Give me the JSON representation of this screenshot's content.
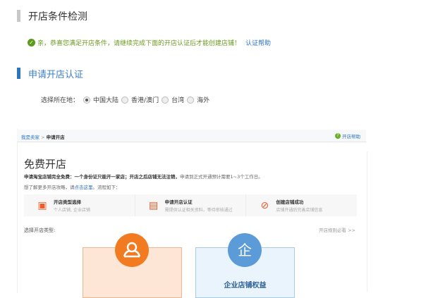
{
  "check_section": {
    "title": "开店条件检测",
    "message": "亲，恭喜您满足开店条件，请继续完成下面的开店认证后才能创建店铺！",
    "help_link": "认证帮助"
  },
  "auth_section": {
    "title": "申请开店认证",
    "location_label": "选择所在地：",
    "options": [
      "中国大陆",
      "香港/澳门",
      "台湾",
      "海外"
    ],
    "selected": "中国大陆"
  },
  "embedded": {
    "breadcrumb": {
      "root": "我是卖家",
      "sep": " > ",
      "current": "申请开店"
    },
    "help": "开店帮助",
    "title": "免费开店",
    "desc_bold": "申请淘宝店铺完全免费：一个身份证只能开一家店；开店之后店铺无法注销，",
    "desc_rest": "申请到正式开通预计需要1~3个工作日。",
    "more_prefix": "想了解更多开店攻略，请",
    "more_link": "点击这里",
    "more_suffix": "。流程如下：",
    "steps": [
      {
        "title": "开店类型选择",
        "sub": "个人店铺, 企业店铺"
      },
      {
        "title": "申请开店认证",
        "sub": "需提供认证相关资料，等待审核通过"
      },
      {
        "title": "创建店铺成功",
        "sub": "店铺开通后完善店铺信息"
      }
    ],
    "select_type": "选择开店类型:",
    "rules_link": "开店规则必看 >>",
    "enterprise_title": "企业店铺权益",
    "enterprise_icon_text": "企"
  }
}
